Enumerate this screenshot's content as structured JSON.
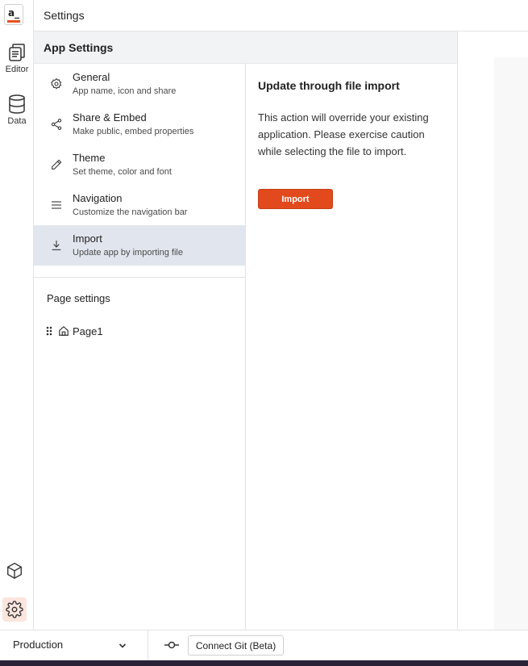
{
  "app": {
    "logo_text": "a_",
    "window_title": "Settings"
  },
  "rail": {
    "items": [
      {
        "label": "Editor",
        "icon": "editor-icon"
      },
      {
        "label": "Data",
        "icon": "database-icon"
      }
    ],
    "bottom": [
      {
        "icon": "cube-icon"
      },
      {
        "icon": "gear-icon",
        "active": true
      }
    ]
  },
  "panel": {
    "title": "App Settings",
    "menu": [
      {
        "title": "General",
        "subtitle": "App name, icon and share",
        "icon": "gear-icon"
      },
      {
        "title": "Share & Embed",
        "subtitle": "Make public, embed properties",
        "icon": "share-icon"
      },
      {
        "title": "Theme",
        "subtitle": "Set theme, color and font",
        "icon": "pencil-icon"
      },
      {
        "title": "Navigation",
        "subtitle": "Customize the navigation bar",
        "icon": "menu-icon"
      },
      {
        "title": "Import",
        "subtitle": "Update app by importing file",
        "icon": "download-icon",
        "active": true
      }
    ],
    "page_settings_label": "Page settings",
    "pages": [
      {
        "name": "Page1",
        "icon": "home-icon"
      }
    ]
  },
  "content": {
    "heading": "Update through file import",
    "body": "This action will override your existing application. Please exercise caution while selecting the file to import.",
    "button_label": "Import"
  },
  "bottombar": {
    "environment": "Production",
    "git_button": "Connect Git (Beta)"
  },
  "colors": {
    "accent": "#e24a1d",
    "active_menu": "#e1e6ee",
    "panel_header": "#f1f3f5"
  }
}
